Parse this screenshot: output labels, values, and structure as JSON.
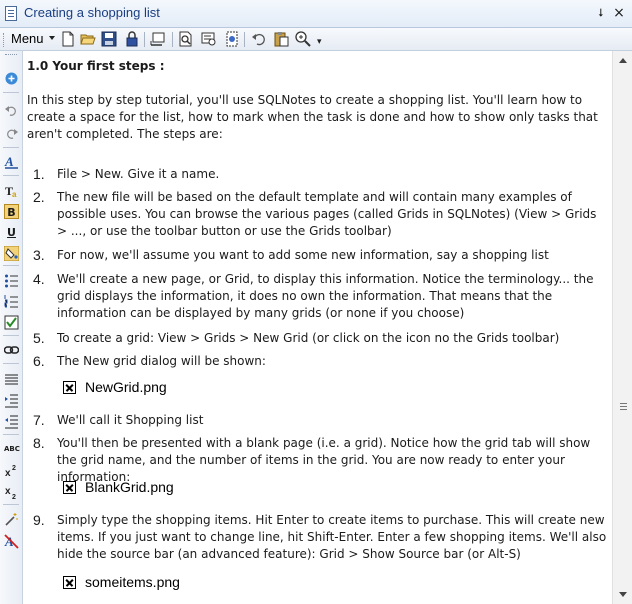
{
  "window": {
    "title": "Creating a shopping list",
    "pin_glyph": "⭣",
    "close_glyph": "×"
  },
  "toolbar": {
    "menu_label": "Menu",
    "icons": [
      "new-file-icon",
      "open-folder-icon",
      "save-icon",
      "lock-icon",
      "view-icon",
      "preview-icon",
      "find-icon",
      "grid-icon",
      "undo-icon",
      "paste-icon",
      "zoom-icon"
    ]
  },
  "left_toolbar": {
    "icons": [
      "add-icon",
      "undo-icon",
      "redo-icon",
      "style-icon",
      "text-icon",
      "bold-icon",
      "underline-icon",
      "fill-icon",
      "bullet-list-icon",
      "numbered-list-icon",
      "checkbox-icon",
      "link-icon",
      "align-icon",
      "indent-icon",
      "outdent-icon",
      "spellcheck-icon",
      "superscript-icon",
      "subscript-icon",
      "magic-icon",
      "clear-format-icon"
    ],
    "labels": {
      "bold": "B",
      "underline": "U",
      "spell": "ABC"
    }
  },
  "document": {
    "heading": "1.0 Your first steps :",
    "intro": "In this step by step tutorial, you'll use SQLNotes to create a shopping list. You'll learn how to create a space for the list, how to mark when the task is done and how to show only tasks that aren't completed. The steps are:",
    "steps": [
      {
        "num": "1.",
        "text": "File > New. Give it a name."
      },
      {
        "num": "2.",
        "text": "The new file will be based on the default template and will contain many examples of possible uses. You can browse the various pages (called Grids in SQLNotes) (View > Grids > ..., or use the toolbar button or use the Grids toolbar)"
      },
      {
        "num": "3.",
        "text": "For now, we'll assume you want to add some new information, say a shopping list"
      },
      {
        "num": "4.",
        "text": "We'll create a new page, or Grid, to display this information. Notice the terminology... the grid displays the information, it does no own the information. That means that the information can be displayed by many grids (or none if you choose)"
      },
      {
        "num": "5.",
        "text": "To create a grid: View > Grids > New Grid (or click on the icon no the Grids toolbar)"
      },
      {
        "num": "6.",
        "text": "The New grid dialog will be shown:",
        "image": "NewGrid.png"
      },
      {
        "num": "7.",
        "text": "We'll call it Shopping list"
      },
      {
        "num": "8.",
        "text": "You'll then be presented with a blank page (i.e. a grid). Notice how the grid tab will show the grid name, and the number of items in the grid. You are now ready to enter your information:",
        "image": "BlankGrid.png"
      },
      {
        "num": "9.",
        "text": "Simply type the shopping items. Hit Enter to create items to purchase. This will create new items. If you just want to change line, hit Shift-Enter. Enter a few shopping items. We'll also hide the source bar (an advanced feature): Grid > Show Source bar (or Alt-S)",
        "image": "someitems.png"
      }
    ]
  },
  "colors": {
    "title_text": "#1a3e82",
    "chrome_bg": "#e6ecf4"
  }
}
